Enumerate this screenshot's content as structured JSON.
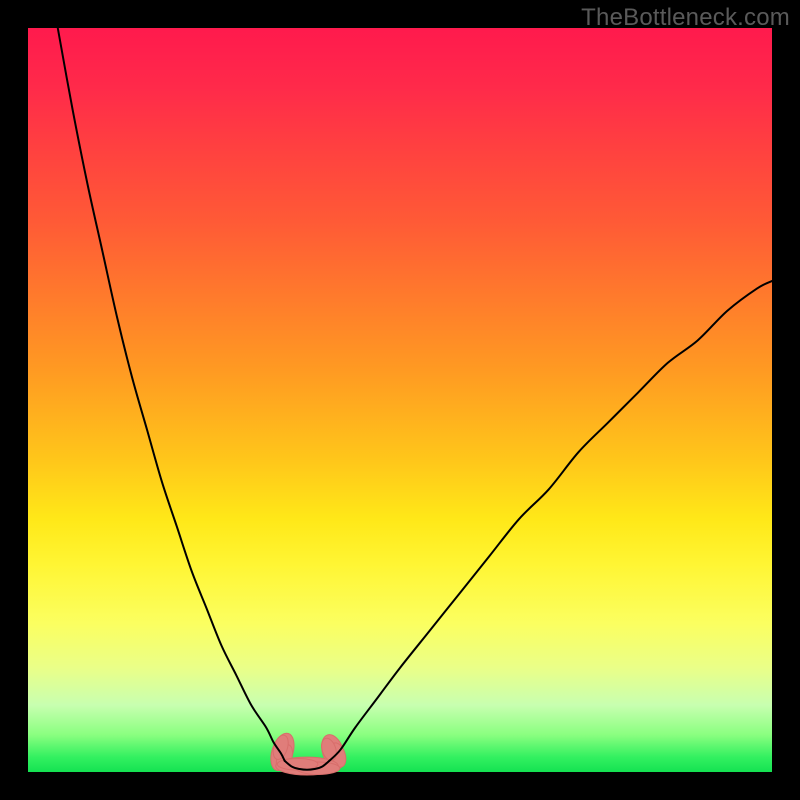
{
  "watermark": "TheBottleneck.com",
  "chart_data": {
    "type": "line",
    "title": "",
    "xlabel": "",
    "ylabel": "",
    "xlim": [
      0,
      100
    ],
    "ylim": [
      0,
      100
    ],
    "grid": false,
    "legend": false,
    "series": [
      {
        "name": "left-curve",
        "x": [
          4,
          6,
          8,
          10,
          12,
          14,
          16,
          18,
          20,
          22,
          24,
          26,
          28,
          30,
          32,
          33,
          34,
          34.5
        ],
        "values": [
          100,
          89,
          79,
          70,
          61,
          53,
          46,
          39,
          33,
          27,
          22,
          17,
          13,
          9,
          6,
          4,
          2.5,
          1.5
        ]
      },
      {
        "name": "right-curve",
        "x": [
          40.5,
          42,
          44,
          47,
          50,
          54,
          58,
          62,
          66,
          70,
          74,
          78,
          82,
          86,
          90,
          94,
          98,
          100
        ],
        "values": [
          1.5,
          3,
          6,
          10,
          14,
          19,
          24,
          29,
          34,
          38,
          43,
          47,
          51,
          55,
          58,
          62,
          65,
          66
        ]
      },
      {
        "name": "valley-floor",
        "x": [
          34.5,
          35.5,
          36.5,
          37.5,
          38.5,
          39.5,
          40.5
        ],
        "values": [
          1.5,
          0.7,
          0.4,
          0.3,
          0.4,
          0.7,
          1.5
        ]
      }
    ],
    "annotations": {
      "blobs": [
        {
          "name": "left-blob",
          "cx": 34.2,
          "cy": 2.7,
          "rx": 1.4,
          "ry": 2.6,
          "rot": 18
        },
        {
          "name": "right-blob",
          "cx": 41.0,
          "cy": 2.7,
          "rx": 1.4,
          "ry": 2.4,
          "rot": -18
        },
        {
          "name": "bottom-blob",
          "cx": 37.5,
          "cy": 0.8,
          "rx": 4.2,
          "ry": 1.2,
          "rot": 0
        }
      ]
    },
    "background_gradient": {
      "direction": "top-to-bottom",
      "stops": [
        {
          "pos": 0,
          "color": "#ff1a4d"
        },
        {
          "pos": 50,
          "color": "#ff9a22"
        },
        {
          "pos": 75,
          "color": "#fff533"
        },
        {
          "pos": 100,
          "color": "#14e252"
        }
      ]
    }
  }
}
